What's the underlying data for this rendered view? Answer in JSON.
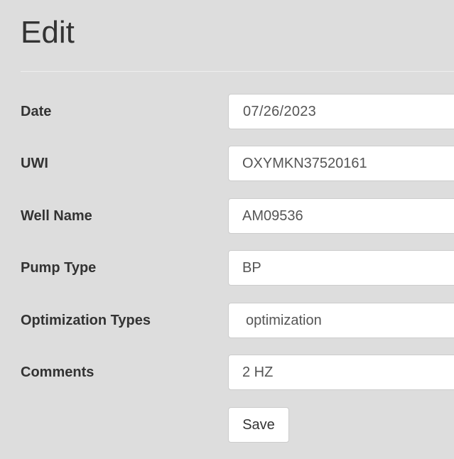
{
  "page": {
    "title": "Edit"
  },
  "form": {
    "date": {
      "label": "Date",
      "value": "07/26/2023"
    },
    "uwi": {
      "label": "UWI",
      "value": "OXYMKN37520161"
    },
    "well_name": {
      "label": "Well Name",
      "value": "AM09536"
    },
    "pump_type": {
      "label": "Pump Type",
      "value": "BP"
    },
    "optimization_types": {
      "label": "Optimization Types",
      "value": "optimization"
    },
    "comments": {
      "label": "Comments",
      "value": "2 HZ"
    }
  },
  "actions": {
    "save_label": "Save"
  }
}
